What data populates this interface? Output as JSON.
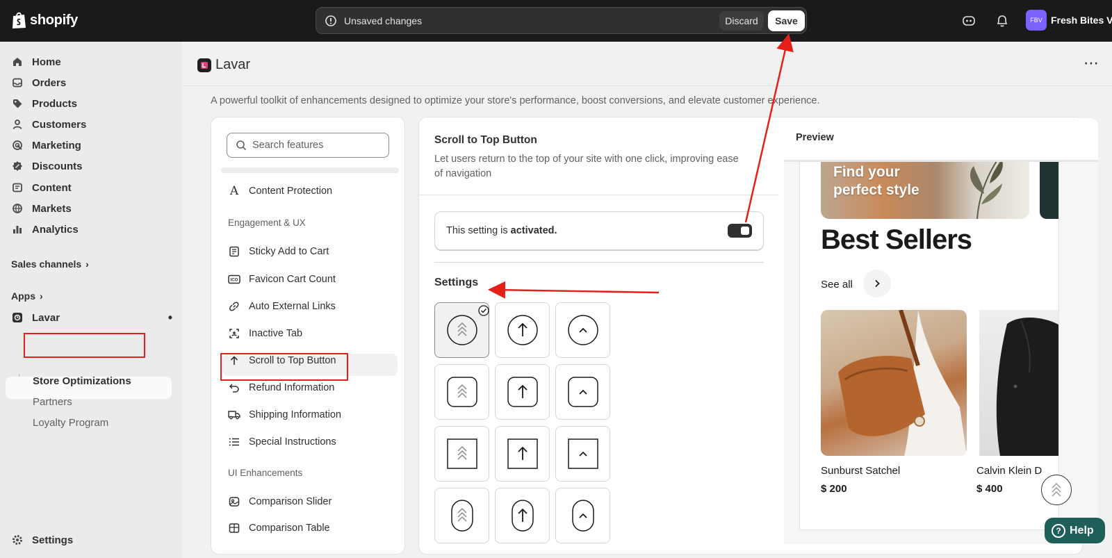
{
  "topbar": {
    "logo_text": "shopify",
    "unsaved_text": "Unsaved changes",
    "discard_label": "Discard",
    "save_label": "Save",
    "store_initials": "FBV",
    "store_name": "Fresh Bites VN"
  },
  "sidebar": {
    "items": [
      {
        "label": "Home",
        "icon": "home-icon"
      },
      {
        "label": "Orders",
        "icon": "inbox-icon"
      },
      {
        "label": "Products",
        "icon": "tag-icon"
      },
      {
        "label": "Customers",
        "icon": "person-icon"
      },
      {
        "label": "Marketing",
        "icon": "target-icon"
      },
      {
        "label": "Discounts",
        "icon": "discount-icon"
      },
      {
        "label": "Content",
        "icon": "content-icon"
      },
      {
        "label": "Markets",
        "icon": "globe-icon"
      },
      {
        "label": "Analytics",
        "icon": "bar-chart-icon"
      }
    ],
    "sales_channels": "Sales channels",
    "apps": "Apps",
    "app_name": "Lavar",
    "app_subitems": [
      "Store Optimizations",
      "Partners",
      "Loyalty Program"
    ],
    "settings": "Settings"
  },
  "page": {
    "app_title": "Lavar",
    "subtitle": "A powerful toolkit of enhancements designed to optimize your store's performance, boost conversions, and elevate customer experience."
  },
  "features": {
    "search_placeholder": "Search features",
    "top_item": "Content Protection",
    "group1": "Engagement & UX",
    "group1_items": [
      "Sticky Add to Cart",
      "Favicon Cart Count",
      "Auto External Links",
      "Inactive Tab",
      "Scroll to Top Button",
      "Refund Information",
      "Shipping Information",
      "Special Instructions"
    ],
    "group2": "UI Enhancements",
    "group2_items": [
      "Comparison Slider",
      "Comparison Table"
    ],
    "selected": "Scroll to Top Button"
  },
  "detail": {
    "title": "Scroll to Top Button",
    "description_line1": "Let users return to the top of your site with one click, improving ease",
    "description_line2": "of navigation",
    "status_prefix": "This setting is ",
    "status_value": "activated.",
    "toggle_on": true,
    "settings_heading": "Settings",
    "style_grid_selected_index": 0
  },
  "preview": {
    "title": "Preview",
    "hero_line1": "Find your",
    "hero_line2": "perfect style",
    "heading": "Best Sellers",
    "see_all": "See all",
    "products": [
      {
        "name": "Sunburst Satchel",
        "price": "$ 200"
      },
      {
        "name": "Calvin Klein D",
        "price": "$ 400"
      }
    ]
  },
  "help_label": "Help",
  "colors": {
    "annotation": "#e5201b",
    "topbar": "#1a1a1a",
    "help": "#1e5f5a"
  }
}
